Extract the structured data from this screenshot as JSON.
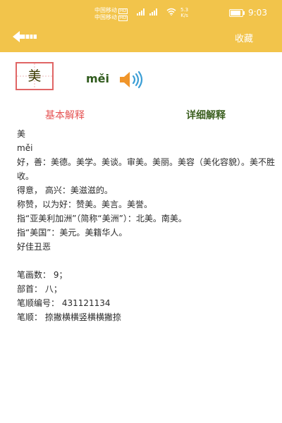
{
  "status_bar": {
    "carrier1": "中国移动",
    "carrier2": "中国移动",
    "hd": "HD",
    "speed_value": "5.3",
    "speed_unit": "K/s",
    "time": "9:03"
  },
  "header": {
    "favorite_label": "收藏",
    "back_icon": "back-arrow-icon"
  },
  "entry": {
    "character": "美",
    "pinyin": "měi",
    "speaker_icon": "speaker-icon"
  },
  "tabs": {
    "basic": "基本解释",
    "detail": "详细解释"
  },
  "definitions": {
    "char": "美",
    "pinyin": "měi",
    "lines": [
      "好，善：美德。美学。美谈。审美。美丽。美容（美化容貌）。美不胜收。",
      "得意， 高兴：美滋滋的。",
      "称赞，以为好：赞美。美言。美誉。",
      "指“亚美利加洲”（简称“美洲”）：北美。南美。",
      "指“美国”：美元。美籍华人。",
      "好佳丑恶"
    ]
  },
  "info": {
    "stroke_count": "笔画数：  9；",
    "radical": "部首：  八；",
    "stroke_code": "笔顺编号：  431121134",
    "stroke_order": "笔顺：  捺撇横横竖横横撇捺"
  },
  "colors": {
    "header_bg": "#f2c44b",
    "tab_active": "#e55353",
    "tab_inactive": "#3c6020",
    "speaker": "#f0952a"
  }
}
